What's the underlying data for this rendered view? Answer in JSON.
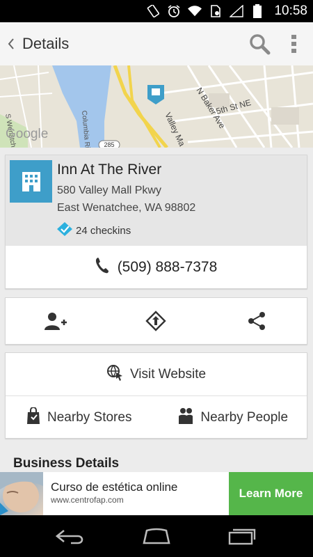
{
  "status_bar": {
    "time": "10:58",
    "icons": [
      "rotate-icon",
      "alarm-icon",
      "wifi-icon",
      "sim-icon",
      "signal-icon",
      "battery-icon"
    ]
  },
  "action_bar": {
    "title": "Details",
    "icons": [
      "back-chevron-icon",
      "search-icon",
      "overflow-menu-icon"
    ]
  },
  "map": {
    "watermark": "Google",
    "labels": [
      "Columbia Riv",
      "N Baker Ave",
      "5th St NE",
      "Valley Ma",
      "S Wenatchee Ave",
      "285"
    ]
  },
  "venue": {
    "name": "Inn At The River",
    "address_line1": "580 Valley Mall Pkwy",
    "address_line2": "East Wenatchee, WA 98802",
    "checkins": "24 checkins",
    "phone": "(509) 888-7378",
    "icon": "hotel-building-icon"
  },
  "actions": {
    "icons": [
      "add-friend-icon",
      "directions-icon",
      "share-icon"
    ]
  },
  "links": {
    "visit_website": "Visit Website",
    "nearby_stores": "Nearby Stores",
    "nearby_people": "Nearby People"
  },
  "section": {
    "business_details": "Business Details"
  },
  "ad": {
    "title": "Curso de estética online",
    "url": "www.centrofap.com",
    "cta": "Learn More"
  },
  "colors": {
    "accent_blue": "#3e9ec9",
    "ad_green": "#55b64a",
    "card_gray": "#e6e6e6"
  }
}
